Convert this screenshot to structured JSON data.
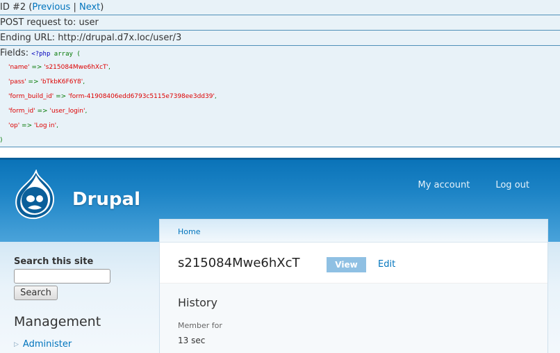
{
  "debug": {
    "id_prefix": "ID #2 (",
    "previous": "Previous",
    "separator": " | ",
    "next": "Next",
    "id_suffix": ")",
    "post_request": "POST request to: user",
    "ending_url": "Ending URL: http://drupal.d7x.loc/user/3",
    "fields_label": "Fields: ",
    "php_open": "<?php",
    "array_open": " array (",
    "fields": [
      {
        "key": "'name'",
        "arrow": " => ",
        "value": "'s215084Mwe6hXcT'"
      },
      {
        "key": "'pass'",
        "arrow": " => ",
        "value": "'bTkbK6F6Y8'"
      },
      {
        "key": "'form_build_id'",
        "arrow": " => ",
        "value": "'form-41908406edd6793c5115e7398ee3dd39'"
      },
      {
        "key": "'form_id'",
        "arrow": " => ",
        "value": "'user_login'"
      },
      {
        "key": "'op'",
        "arrow": " => ",
        "value": "'Log in'"
      }
    ],
    "array_close": ")"
  },
  "header": {
    "site_name": "Drupal",
    "menu": {
      "my_account": "My account",
      "log_out": "Log out"
    }
  },
  "sidebar": {
    "search_title": "Search this site",
    "search_button": "Search",
    "search_value": "",
    "management_title": "Management",
    "management_items": [
      "Administer"
    ]
  },
  "main": {
    "breadcrumb": "Home",
    "title": "s215084Mwe6hXcT",
    "tabs": {
      "view": "View",
      "edit": "Edit"
    },
    "history_title": "History",
    "member_for_label": "Member for",
    "member_for_value": "13 sec"
  },
  "colors": {
    "link": "#0074bd",
    "header_blue": "#1d84c6",
    "debug_bg": "#e8f2f8",
    "php_string": "#dd0000",
    "php_keyword": "#007700"
  }
}
